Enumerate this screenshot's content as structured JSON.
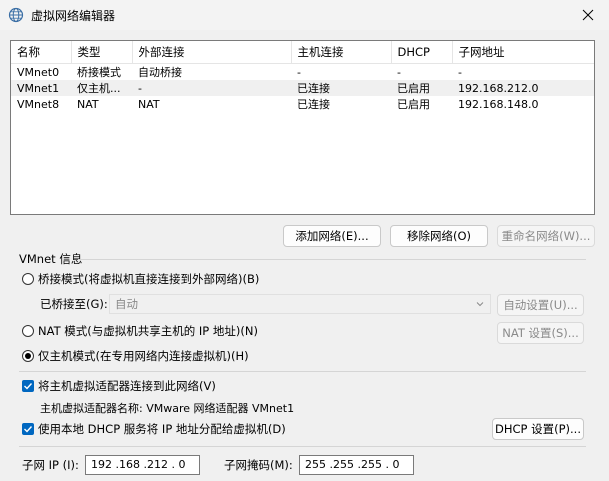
{
  "window": {
    "title": "虚拟网络编辑器"
  },
  "table": {
    "headers": [
      "名称",
      "类型",
      "外部连接",
      "主机连接",
      "DHCP",
      "子网地址"
    ],
    "rows": [
      [
        "VMnet0",
        "桥接模式",
        "自动桥接",
        "-",
        "-",
        "-"
      ],
      [
        "VMnet1",
        "仅主机...",
        "-",
        "已连接",
        "已启用",
        "192.168.212.0"
      ],
      [
        "VMnet8",
        "NAT",
        "NAT",
        "已连接",
        "已启用",
        "192.168.148.0"
      ]
    ]
  },
  "buttons": {
    "add_network": "添加网络(E)...",
    "remove_network": "移除网络(O)",
    "rename_network": "重命名网络(W)...",
    "auto_settings": "自动设置(U)...",
    "nat_settings": "NAT 设置(S)...",
    "dhcp_settings": "DHCP 设置(P)..."
  },
  "vmnet_info": {
    "section_title": "VMnet 信息",
    "bridged_label": "桥接模式(将虚拟机直接连接到外部网络)(B)",
    "bridged_to_label": "已桥接至(G):",
    "bridged_to_value": "自动",
    "nat_label": "NAT 模式(与虚拟机共享主机的 IP 地址)(N)",
    "host_only_label": "仅主机模式(在专用网络内连接虚拟机)(H)",
    "selected_mode": "host_only",
    "connect_adapter_label": "将主机虚拟适配器连接到此网络(V)",
    "connect_adapter_checked": true,
    "adapter_name_text": "主机虚拟适配器名称: VMware 网络适配器 VMnet1",
    "dhcp_label": "使用本地 DHCP 服务将 IP 地址分配给虚拟机(D)",
    "dhcp_checked": true,
    "subnet_ip_label": "子网 IP (I):",
    "subnet_ip_value": "192 .168 .212 .  0",
    "subnet_mask_label": "子网掩码(M):",
    "subnet_mask_value": "255 .255 .255 .  0"
  },
  "icons": {
    "title": "globe-icon",
    "close": "close-icon",
    "dropdown": "chevron-down-icon",
    "check": "check-icon"
  },
  "colors": {
    "accent": "#0067c0",
    "disabled_text": "#8a8a8a"
  }
}
